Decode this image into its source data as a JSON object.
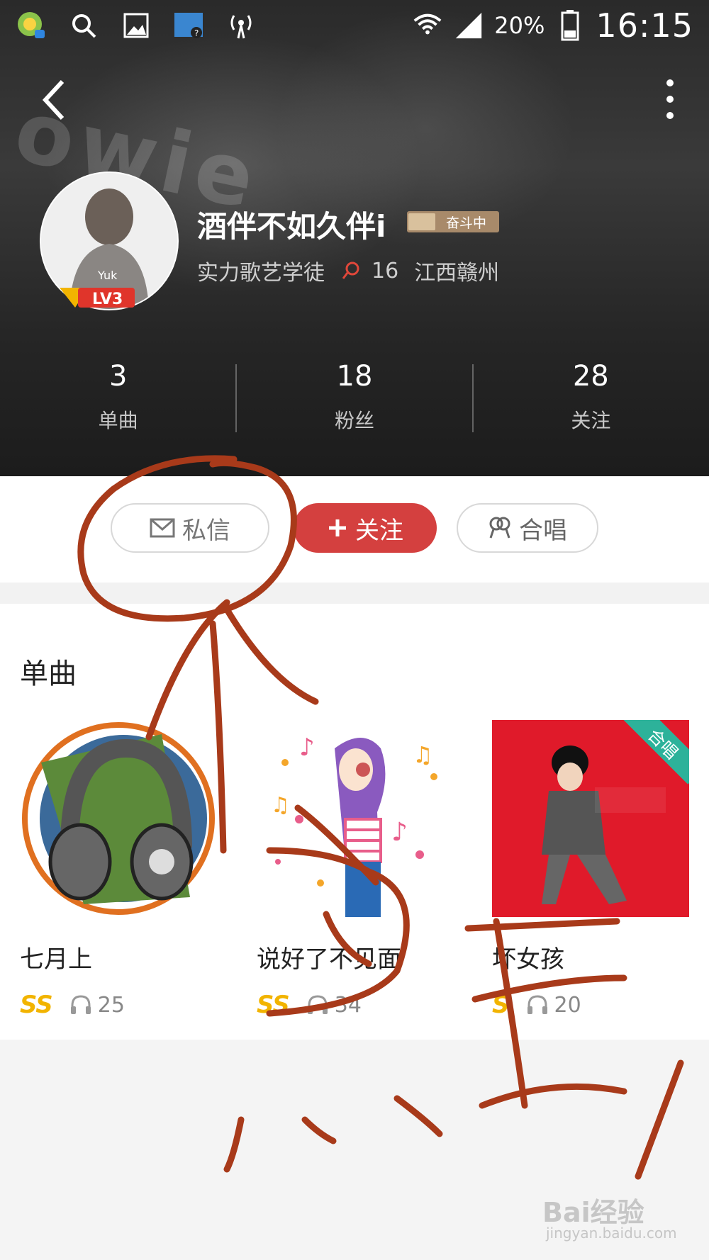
{
  "status_bar": {
    "wifi_icon": "wifi-icon",
    "signal_icon": "signal-icon",
    "battery": "20%",
    "time": "16:15",
    "icons_left": [
      "app-notification-icon",
      "search-icon",
      "gallery-icon",
      "network-monitor-icon",
      "hotspot-icon"
    ]
  },
  "toolbar": {
    "back_icon": "chevron-left-icon",
    "more_icon": "more-vertical-icon"
  },
  "profile": {
    "nickname": "酒伴不如久伴i",
    "rank_badge": "奋斗中",
    "level": "LV3",
    "title": "实力歌艺学徒",
    "flower_count": "16",
    "location": "江西赣州"
  },
  "stats": [
    {
      "value": "3",
      "label": "单曲"
    },
    {
      "value": "18",
      "label": "粉丝"
    },
    {
      "value": "28",
      "label": "关注"
    }
  ],
  "actions": {
    "message_label": "私信",
    "follow_label": "关注",
    "chorus_label": "合唱"
  },
  "singles": {
    "section_title": "单曲",
    "items": [
      {
        "title": "七月上",
        "quality": "SS",
        "plays": "25"
      },
      {
        "title": "说好了不见面",
        "quality": "SS",
        "plays": "34"
      },
      {
        "title": "坏女孩",
        "quality": "S",
        "plays": "20",
        "tag": "合唱"
      }
    ]
  },
  "watermark": {
    "brand": "Bai经验",
    "url": "jingyan.baidu.com"
  },
  "colors": {
    "accent_red": "#d4403f",
    "quality_gold": "#f2b400",
    "chorus_green": "#2db29a",
    "annotation_ink": "#a83a1a"
  }
}
